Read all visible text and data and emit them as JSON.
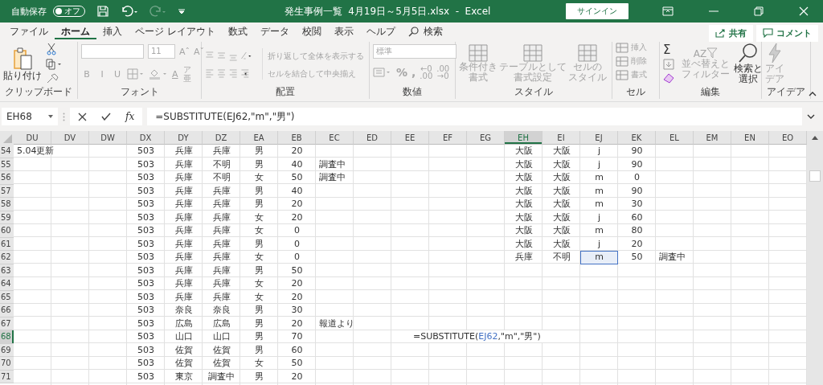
{
  "title_bar": {
    "autosave_label": "自動保存",
    "autosave": {
      "on": false,
      "label": "オフ"
    },
    "title": "発生事例一覧  4月19日～5月5日.xlsx  -  Excel",
    "signin": "サインイン"
  },
  "tabs": [
    {
      "label": "ファイル",
      "selected": false
    },
    {
      "label": "ホーム",
      "selected": true
    },
    {
      "label": "挿入",
      "selected": false
    },
    {
      "label": "ページ レイアウト",
      "selected": false
    },
    {
      "label": "数式",
      "selected": false
    },
    {
      "label": "データ",
      "selected": false
    },
    {
      "label": "校閲",
      "selected": false
    },
    {
      "label": "表示",
      "selected": false
    },
    {
      "label": "ヘルプ",
      "selected": false
    }
  ],
  "tell_me": "検索",
  "share": "共有",
  "comment": "コメント",
  "ribbon": {
    "clipboard": {
      "paste": "貼り付け",
      "label": "クリップボード"
    },
    "font": {
      "size": "11",
      "size_buttons": [
        "Aˆ",
        "Aˇ"
      ],
      "format_buttons": [
        "B",
        "I",
        "U"
      ],
      "color_letter": "A",
      "phonetic": "ア亜",
      "label": "フォント",
      "disabled": true
    },
    "alignment": {
      "wrap": "折り返して全体を表示する",
      "merge": "セルを結合して中央揃え",
      "label": "配置",
      "disabled": true
    },
    "number": {
      "format": "標準",
      "percent": "%",
      "comma": ",",
      "decimal_buttons": [
        [
          "←0",
          ".00"
        ],
        [
          ".00",
          "→0"
        ]
      ],
      "label": "数値",
      "disabled": true
    },
    "styles": {
      "buttons": [
        {
          "lines": [
            "条件付き",
            "書式"
          ]
        },
        {
          "lines": [
            "テーブルとして",
            "書式設定"
          ]
        },
        {
          "lines": [
            "セルの",
            "スタイル"
          ]
        }
      ],
      "label": "スタイル",
      "disabled": true
    },
    "cells": {
      "buttons": [
        "挿入",
        "削除",
        "書式"
      ],
      "label": "セル",
      "disabled": true
    },
    "editing": {
      "autosum": "Σ",
      "sort": {
        "letters": [
          "A",
          "Z"
        ],
        "lines": [
          "並べ替えと",
          "フィルター"
        ],
        "disabled": true
      },
      "find": {
        "lines": [
          "検索と",
          "選択"
        ],
        "disabled": false
      },
      "label": "編集"
    },
    "ideas": {
      "lines": [
        "アイ",
        "デア"
      ],
      "label": "アイデア",
      "disabled": true
    }
  },
  "formula_bar": {
    "name_box": "EH68",
    "fx": "fx",
    "formula": "=SUBSTITUTE(EJ62,\"m\",\"男\")"
  },
  "sheet": {
    "columns": [
      {
        "label": "DU",
        "selected": false
      },
      {
        "label": "DV",
        "selected": false
      },
      {
        "label": "DW",
        "selected": false
      },
      {
        "label": "DX",
        "selected": false
      },
      {
        "label": "DY",
        "selected": false
      },
      {
        "label": "DZ",
        "selected": false
      },
      {
        "label": "EA",
        "selected": false
      },
      {
        "label": "EB",
        "selected": false
      },
      {
        "label": "EC",
        "selected": false
      },
      {
        "label": "ED",
        "selected": false
      },
      {
        "label": "EE",
        "selected": false
      },
      {
        "label": "EF",
        "selected": false
      },
      {
        "label": "EG",
        "selected": false
      },
      {
        "label": "EH",
        "selected": true
      },
      {
        "label": "EI",
        "selected": false
      },
      {
        "label": "EJ",
        "selected": false
      },
      {
        "label": "EK",
        "selected": false
      },
      {
        "label": "EL",
        "selected": false
      },
      {
        "label": "EM",
        "selected": false
      },
      {
        "label": "EN",
        "selected": false
      },
      {
        "label": "EO",
        "selected": false
      }
    ],
    "rows": [
      {
        "num": "54",
        "selected": false,
        "cells": [
          {
            "text": "5.04更新",
            "kind": "note"
          },
          "",
          "",
          "503",
          "兵庫",
          "兵庫",
          "男",
          "20",
          "",
          "",
          "",
          "",
          "",
          "大阪",
          "大阪",
          "j",
          "90",
          "",
          "",
          "",
          ""
        ]
      },
      {
        "num": "55",
        "selected": false,
        "cells": [
          "",
          "",
          "",
          "503",
          "兵庫",
          "不明",
          "男",
          "40",
          {
            "text": "調査中",
            "kind": "note"
          },
          "",
          "",
          "",
          "",
          "大阪",
          "大阪",
          "j",
          "90",
          "",
          "",
          "",
          ""
        ]
      },
      {
        "num": "56",
        "selected": false,
        "cells": [
          "",
          "",
          "",
          "503",
          "兵庫",
          "不明",
          "女",
          "50",
          {
            "text": "調査中",
            "kind": "note"
          },
          "",
          "",
          "",
          "",
          "大阪",
          "大阪",
          "m",
          "0",
          "",
          "",
          "",
          ""
        ]
      },
      {
        "num": "57",
        "selected": false,
        "cells": [
          "",
          "",
          "",
          "503",
          "兵庫",
          "兵庫",
          "男",
          "40",
          "",
          "",
          "",
          "",
          "",
          "大阪",
          "大阪",
          "m",
          "90",
          "",
          "",
          "",
          ""
        ]
      },
      {
        "num": "58",
        "selected": false,
        "cells": [
          "",
          "",
          "",
          "503",
          "兵庫",
          "兵庫",
          "男",
          "20",
          "",
          "",
          "",
          "",
          "",
          "大阪",
          "大阪",
          "m",
          "30",
          "",
          "",
          "",
          ""
        ]
      },
      {
        "num": "59",
        "selected": false,
        "cells": [
          "",
          "",
          "",
          "503",
          "兵庫",
          "兵庫",
          "女",
          "20",
          "",
          "",
          "",
          "",
          "",
          "大阪",
          "大阪",
          "j",
          "60",
          "",
          "",
          "",
          ""
        ]
      },
      {
        "num": "60",
        "selected": false,
        "cells": [
          "",
          "",
          "",
          "503",
          "兵庫",
          "兵庫",
          "女",
          "0",
          "",
          "",
          "",
          "",
          "",
          "大阪",
          "大阪",
          "m",
          "80",
          "",
          "",
          "",
          ""
        ]
      },
      {
        "num": "61",
        "selected": false,
        "cells": [
          "",
          "",
          "",
          "503",
          "兵庫",
          "兵庫",
          "男",
          "0",
          "",
          "",
          "",
          "",
          "",
          "大阪",
          "大阪",
          "j",
          "20",
          "",
          "",
          "",
          ""
        ]
      },
      {
        "num": "62",
        "selected": false,
        "cells": [
          "",
          "",
          "",
          "503",
          "兵庫",
          "兵庫",
          "女",
          "0",
          "",
          "",
          "",
          "",
          "",
          "兵庫",
          "不明",
          {
            "text": "m",
            "kind": "reference"
          },
          "50",
          {
            "text": "調査中",
            "kind": "note"
          },
          "",
          "",
          ""
        ]
      },
      {
        "num": "63",
        "selected": false,
        "cells": [
          "",
          "",
          "",
          "503",
          "兵庫",
          "兵庫",
          "男",
          "50",
          "",
          "",
          "",
          "",
          "",
          "",
          "",
          "",
          "",
          "",
          "",
          "",
          ""
        ]
      },
      {
        "num": "64",
        "selected": false,
        "cells": [
          "",
          "",
          "",
          "503",
          "兵庫",
          "兵庫",
          "女",
          "20",
          "",
          "",
          "",
          "",
          "",
          "",
          "",
          "",
          "",
          "",
          "",
          "",
          ""
        ]
      },
      {
        "num": "65",
        "selected": false,
        "cells": [
          "",
          "",
          "",
          "503",
          "兵庫",
          "兵庫",
          "女",
          "20",
          "",
          "",
          "",
          "",
          "",
          "",
          "",
          "",
          "",
          "",
          "",
          "",
          ""
        ]
      },
      {
        "num": "66",
        "selected": false,
        "cells": [
          "",
          "",
          "",
          "503",
          "奈良",
          "奈良",
          "男",
          "30",
          "",
          "",
          "",
          "",
          "",
          "",
          "",
          "",
          "",
          "",
          "",
          "",
          ""
        ]
      },
      {
        "num": "67",
        "selected": false,
        "cells": [
          "",
          "",
          "",
          "503",
          "広島",
          "広島",
          "男",
          "20",
          {
            "text": "報道より",
            "kind": "note"
          },
          "",
          "",
          "",
          "",
          "",
          "",
          "",
          "",
          "",
          "",
          "",
          ""
        ]
      },
      {
        "num": "68",
        "selected": true,
        "cells": [
          "",
          "",
          "",
          "503",
          "山口",
          "山口",
          "男",
          "70",
          "",
          "",
          "",
          "",
          "",
          {
            "kind": "edit",
            "parts": [
              {
                "text": "=SUBSTITUTE("
              },
              {
                "text": "EJ62",
                "color": "#4472c4"
              },
              {
                "text": ",\"m\",\"男\")"
              }
            ]
          },
          "",
          "",
          "",
          "",
          "",
          "",
          ""
        ]
      },
      {
        "num": "69",
        "selected": false,
        "cells": [
          "",
          "",
          "",
          "503",
          "佐賀",
          "佐賀",
          "男",
          "60",
          "",
          "",
          "",
          "",
          "",
          "",
          "",
          "",
          "",
          "",
          "",
          "",
          ""
        ]
      },
      {
        "num": "70",
        "selected": false,
        "cells": [
          "",
          "",
          "",
          "503",
          "佐賀",
          "佐賀",
          "女",
          "50",
          "",
          "",
          "",
          "",
          "",
          "",
          "",
          "",
          "",
          "",
          "",
          "",
          ""
        ]
      },
      {
        "num": "71",
        "selected": false,
        "cells": [
          "",
          "",
          "",
          "503",
          "東京",
          "調査中",
          "男",
          "20",
          "",
          "",
          "",
          "",
          "",
          "",
          "",
          "",
          "",
          "",
          "",
          "",
          ""
        ]
      }
    ]
  }
}
